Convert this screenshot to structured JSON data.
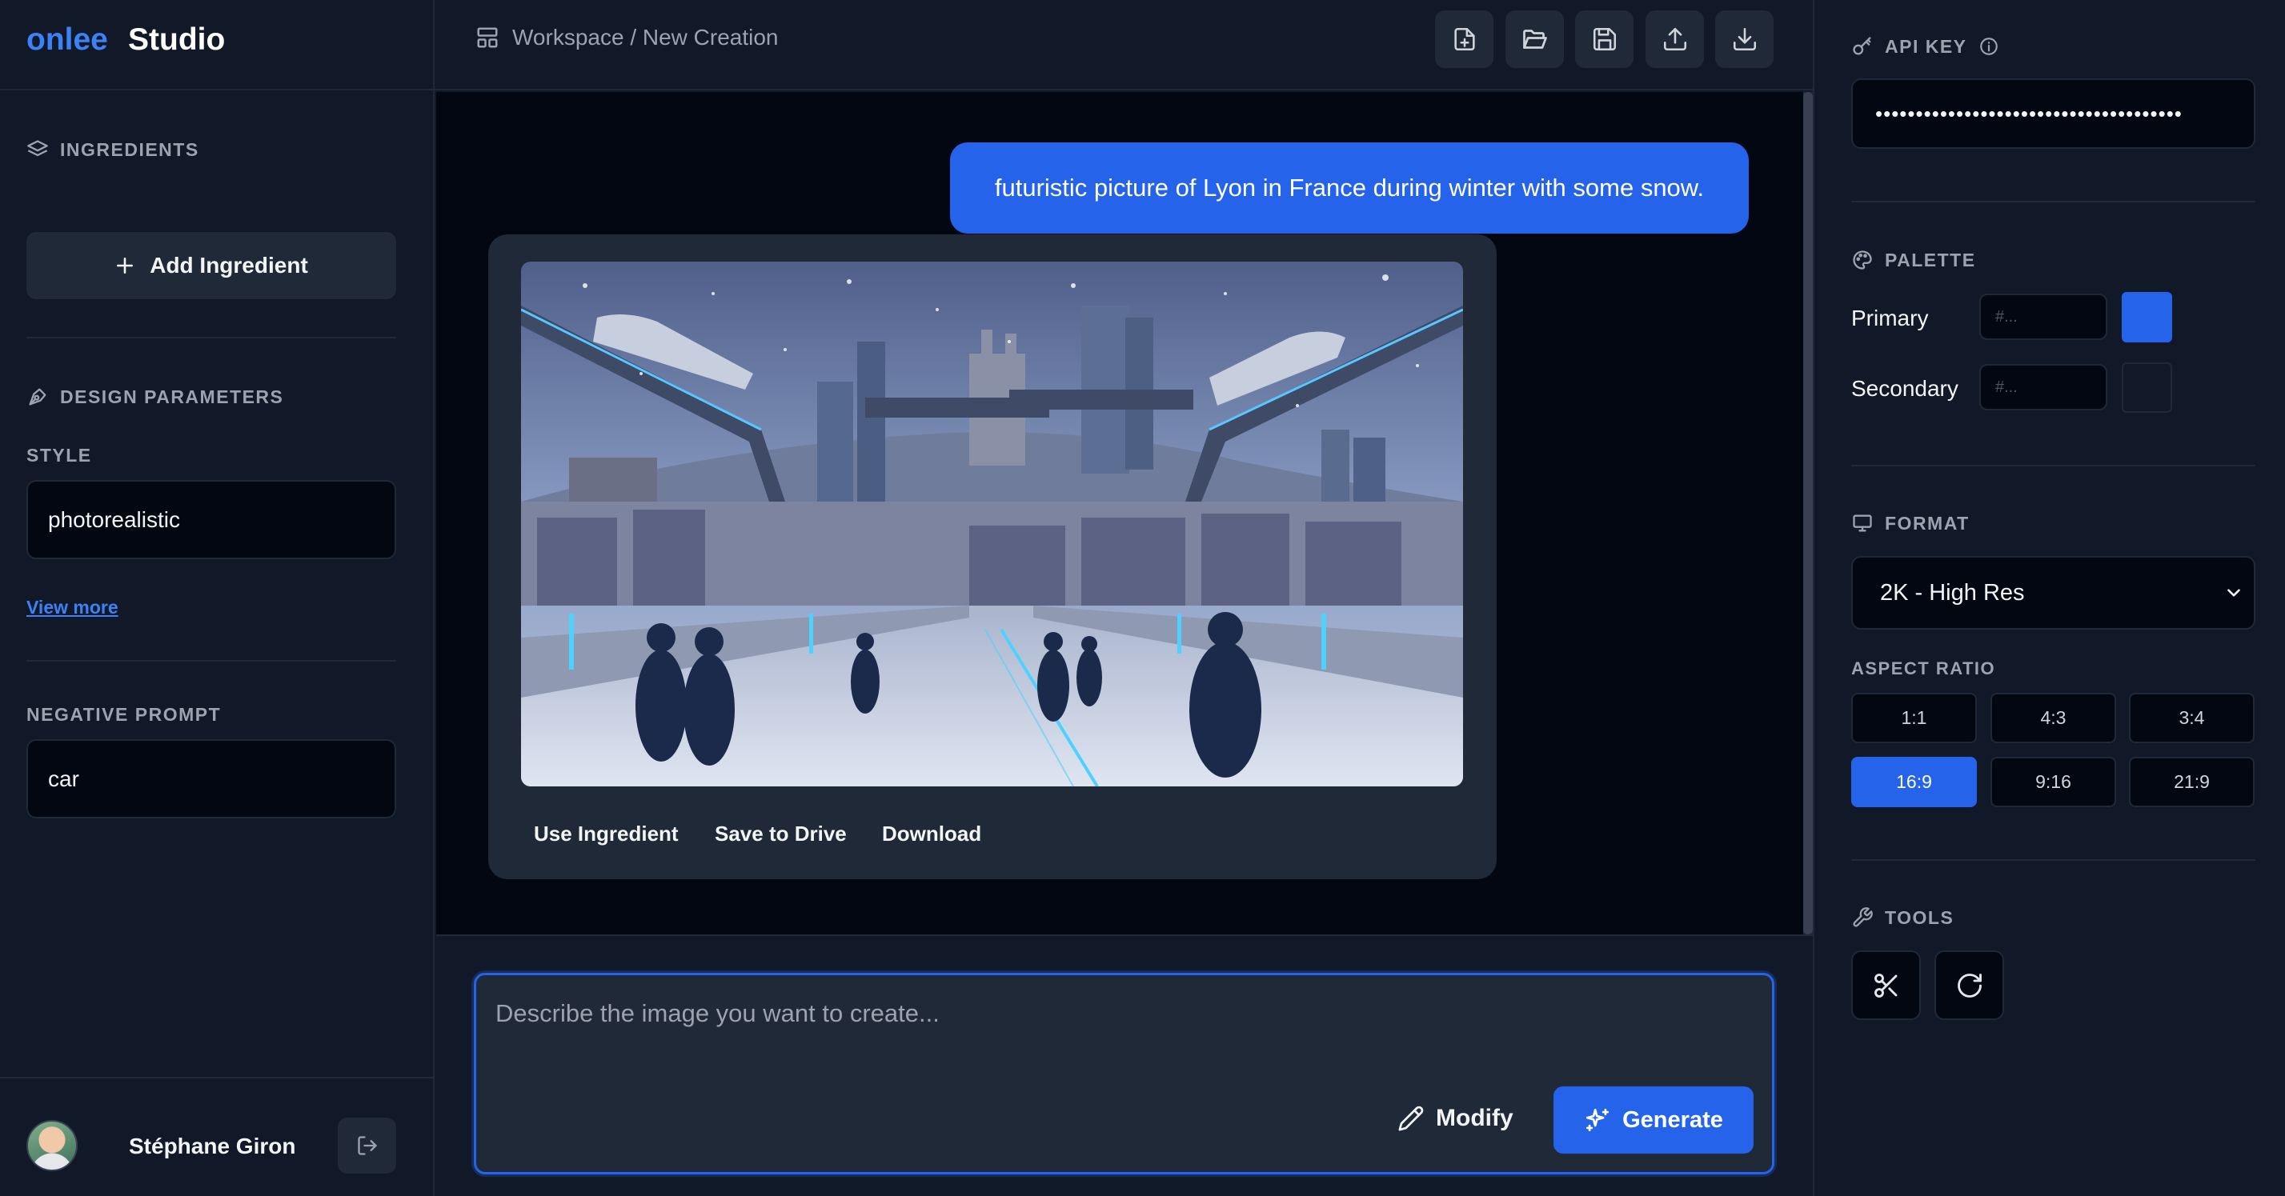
{
  "brand": {
    "part1": "onlee",
    "part2": "Studio"
  },
  "left_sidebar": {
    "ingredients_title": "INGREDIENTS",
    "add_ingredient_label": "Add Ingredient",
    "design_params_title": "DESIGN PARAMETERS",
    "style_label": "STYLE",
    "style_value": "photorealistic",
    "view_more": "View more",
    "negative_prompt_label": "NEGATIVE PROMPT",
    "negative_prompt_value": "car"
  },
  "user": {
    "name": "Stéphane Giron"
  },
  "header": {
    "breadcrumb": "Workspace / New Creation",
    "toolbar_icons": [
      "new-file-icon",
      "open-folder-icon",
      "save-icon",
      "upload-icon",
      "download-icon"
    ]
  },
  "chat": {
    "user_message": "futuristic picture of Lyon in France during winter with some snow.",
    "result_actions": {
      "use_ingredient": "Use Ingredient",
      "save_to_drive": "Save to Drive",
      "download": "Download"
    }
  },
  "prompt": {
    "placeholder": "Describe the image you want to create...",
    "modify_label": "Modify",
    "generate_label": "Generate"
  },
  "right_panel": {
    "api_key_title": "API KEY",
    "api_key_value": "••••••••••••••••••••••••••••••••••••••",
    "palette_title": "PALETTE",
    "primary_label": "Primary",
    "primary_placeholder": "#...",
    "primary_color": "#2563eb",
    "secondary_label": "Secondary",
    "secondary_placeholder": "#...",
    "secondary_color": "#111827",
    "format_title": "FORMAT",
    "format_value": "2K - High Res",
    "aspect_ratio_title": "ASPECT RATIO",
    "aspect_ratios": [
      "1:1",
      "4:3",
      "3:4",
      "16:9",
      "9:16",
      "21:9"
    ],
    "aspect_ratio_selected": "16:9",
    "tools_title": "TOOLS",
    "tools": [
      "scissors-icon",
      "rotate-icon"
    ]
  },
  "colors": {
    "accent": "#2563eb",
    "brand_blue": "#3b82f6",
    "background": "#111827",
    "canvas": "#030712"
  }
}
